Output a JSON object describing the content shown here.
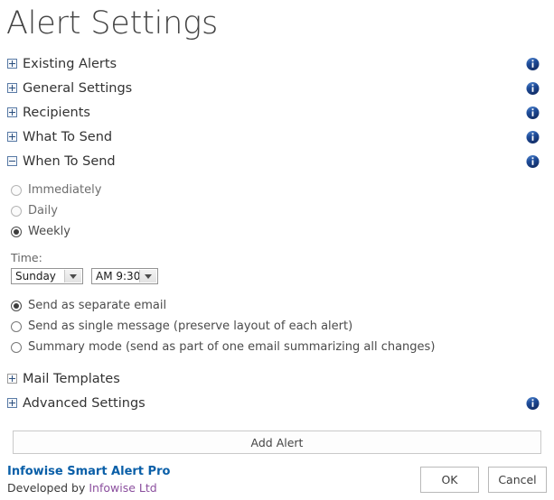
{
  "page": {
    "title": "Alert Settings"
  },
  "sections": [
    {
      "label": "Existing Alerts",
      "expanded": false,
      "info": "info-icon"
    },
    {
      "label": "General Settings",
      "expanded": false,
      "info": "info-icon"
    },
    {
      "label": "Recipients",
      "expanded": false,
      "info": "info-icon"
    },
    {
      "label": "What To Send",
      "expanded": false,
      "info": "info-icon"
    },
    {
      "label": "When To Send",
      "expanded": true,
      "info": "info-icon"
    }
  ],
  "when_to_send": {
    "frequency": {
      "options": [
        {
          "label": "Immediately",
          "selected": false
        },
        {
          "label": "Daily",
          "selected": false
        },
        {
          "label": "Weekly",
          "selected": true
        }
      ]
    },
    "time": {
      "label": "Time:",
      "day_value": "Sunday",
      "time_value": "AM 9:30"
    },
    "delivery": {
      "options": [
        {
          "label": "Send as separate email",
          "selected": true
        },
        {
          "label": "Send as single message (preserve layout of each alert)",
          "selected": false
        },
        {
          "label": "Summary mode (send as part of one email summarizing all changes)",
          "selected": false
        }
      ]
    }
  },
  "sections_bottom": [
    {
      "label": "Mail Templates",
      "expanded": false,
      "info": null
    },
    {
      "label": "Advanced Settings",
      "expanded": false,
      "info": "info-icon"
    }
  ],
  "actions": {
    "add_alert": "Add Alert",
    "ok": "OK",
    "cancel": "Cancel"
  },
  "footer": {
    "brand": "Infowise Smart Alert Pro",
    "developed_by": "Developed by ",
    "company_link": "Infowise Ltd"
  },
  "colors": {
    "brand_blue": "#0a5fa8",
    "link_purple": "#8b4f9e",
    "info_icon_blue": "#1f4e9c",
    "toggle_border": "#5a7ba6"
  }
}
